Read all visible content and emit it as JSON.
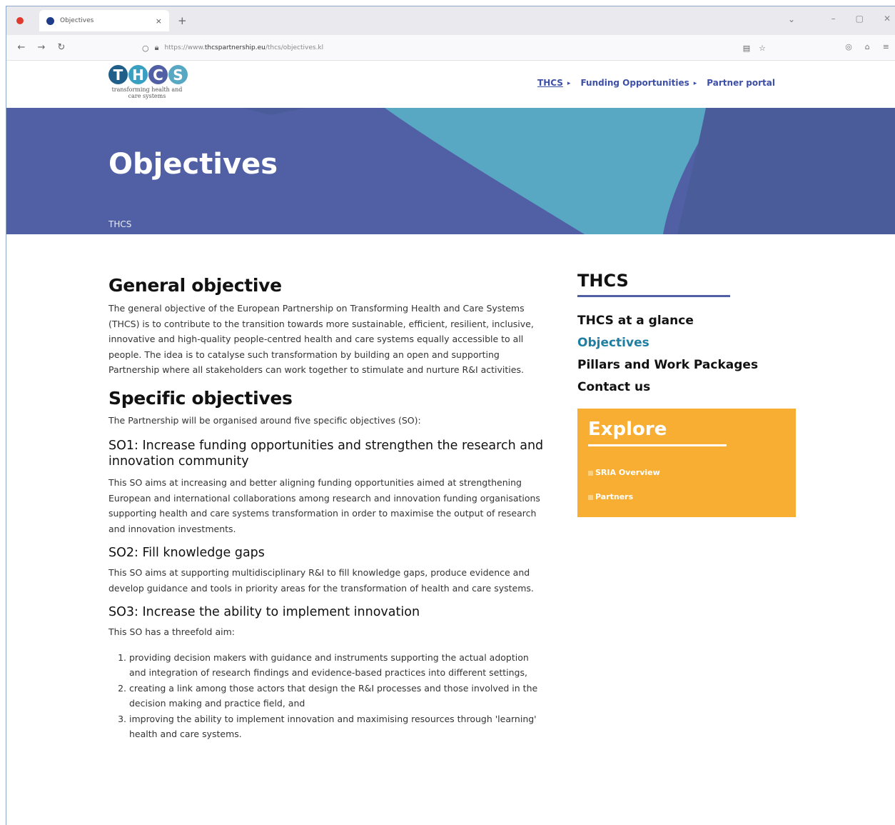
{
  "browser": {
    "tab_title": "Objectives",
    "tab_close": "×",
    "new_tab": "+",
    "url_prefix": "https://www.",
    "url_domain": "thcspartnership.eu",
    "url_path": "/thcs/objectives.kl"
  },
  "site": {
    "logo_text": "THCS",
    "logo_tagline": "transforming health and care systems",
    "nav": [
      {
        "label": "THCS",
        "arrow": "▸"
      },
      {
        "label": "Funding Opportunities",
        "arrow": "▸"
      },
      {
        "label": "Partner portal"
      }
    ]
  },
  "hero": {
    "title": "Objectives",
    "breadcrumb": "THCS"
  },
  "colors": {
    "hero_bg": "#5160a5",
    "hero_teal": "#58a7c3",
    "hero_dark": "#4b5c9a",
    "accent_link": "#1f7fa3",
    "explore_bg": "#f7ae33"
  },
  "main": {
    "general_heading": "General objective",
    "general_text": "The general objective of the European Partnership on Transforming Health and Care Systems (THCS) is to contribute to the transition towards more sustainable, efficient, resilient, inclusive, innovative and high-quality people-centred health and care systems equally accessible to all people. The idea is to catalyse such transformation by building an open and supporting Partnership where all stakeholders can work together to stimulate and nurture R&I activities.",
    "specific_heading": "Specific objectives",
    "specific_intro": "The Partnership will be organised around five specific objectives (SO):",
    "so1_heading": "SO1: Increase funding opportunities and strengthen the research and innovation community",
    "so1_text": "This SO aims at increasing and better aligning funding opportunities aimed at strengthening European and international collaborations among research and innovation funding organisations supporting health and care systems transformation in order to maximise the output of research and innovation investments.",
    "so2_heading": "SO2: Fill knowledge gaps",
    "so2_text": "This SO aims at supporting multidisciplinary R&I to fill knowledge gaps, produce evidence and develop guidance and tools in priority areas for the transformation of health and care systems.",
    "so3_heading": "SO3: Increase the ability to implement innovation",
    "so3_text": "This SO has a threefold aim:",
    "so3_items": [
      "providing decision makers with guidance and instruments supporting the actual adoption and integration of research findings and evidence-based practices into different settings,",
      "creating a link among those actors that design the R&I processes and those involved in the decision making and practice field, and",
      "improving the ability to implement innovation and maximising resources through 'learning' health and care systems."
    ]
  },
  "sidebar": {
    "heading": "THCS",
    "links": [
      "THCS at a glance",
      "Objectives",
      "Pillars and Work Packages",
      "Contact us"
    ],
    "explore_title": "Explore",
    "explore_links": [
      "SRIA Overview",
      "Partners"
    ]
  }
}
